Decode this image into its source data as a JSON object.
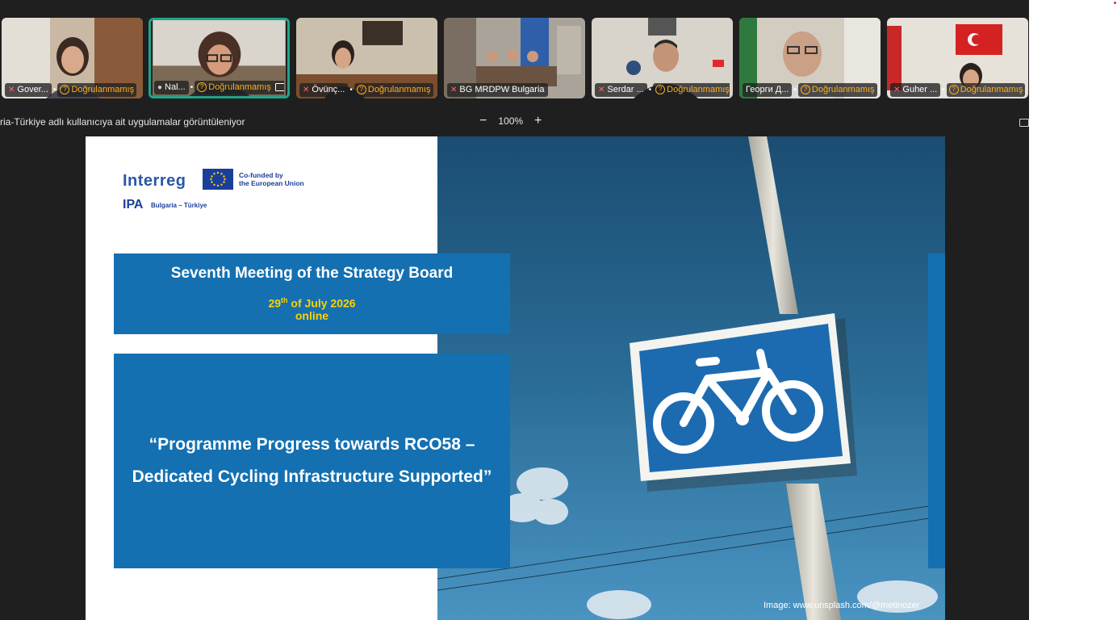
{
  "participants": [
    {
      "name": "Gover...",
      "mic": "muted",
      "status": "Doğrulanmamış"
    },
    {
      "name": "Nal...",
      "mic": "on",
      "status": "Doğrulanmamış",
      "active": true,
      "screen_share": true
    },
    {
      "name": "Övünç...",
      "mic": "muted",
      "status": "Doğrulanmamış"
    },
    {
      "name": "BG MRDPW Bulgaria",
      "mic": "muted",
      "status": ""
    },
    {
      "name": "Serdar ...",
      "mic": "muted",
      "status": "Doğrulanmamış"
    },
    {
      "name": "Георги Д...",
      "mic": "none",
      "status": "Doğrulanmamış"
    },
    {
      "name": "Guher ...",
      "mic": "muted",
      "status": "Doğrulanmamış"
    }
  ],
  "share_bar": {
    "info": "ria-Türkiye adlı kullanıcıya ait uygulamalar görüntüleniyor",
    "zoom_out": "−",
    "zoom_level": "100%",
    "zoom_in": "+"
  },
  "slide": {
    "logo": {
      "interreg": "Interreg",
      "cofund_line1": "Co-funded by",
      "cofund_line2": "the European Union",
      "ipa": "IPA",
      "region": "Bulgaria – Türkiye"
    },
    "meeting_title": "Seventh Meeting of the Strategy Board",
    "date_day": "29",
    "date_suffix": "th",
    "date_rest": " of July 2026",
    "mode": "online",
    "topic": "“Programme Progress towards RCO58 – Dedicated Cycling Infrastructure Supported”",
    "image_credit": "Image: www.unsplash.com/@metinozer"
  },
  "colors": {
    "app_background": "#1f1f1f",
    "slide_blue": "#1470b0",
    "date_yellow": "#ffd200",
    "warning_orange": "#ffb020",
    "active_border": "#1ea58a"
  }
}
